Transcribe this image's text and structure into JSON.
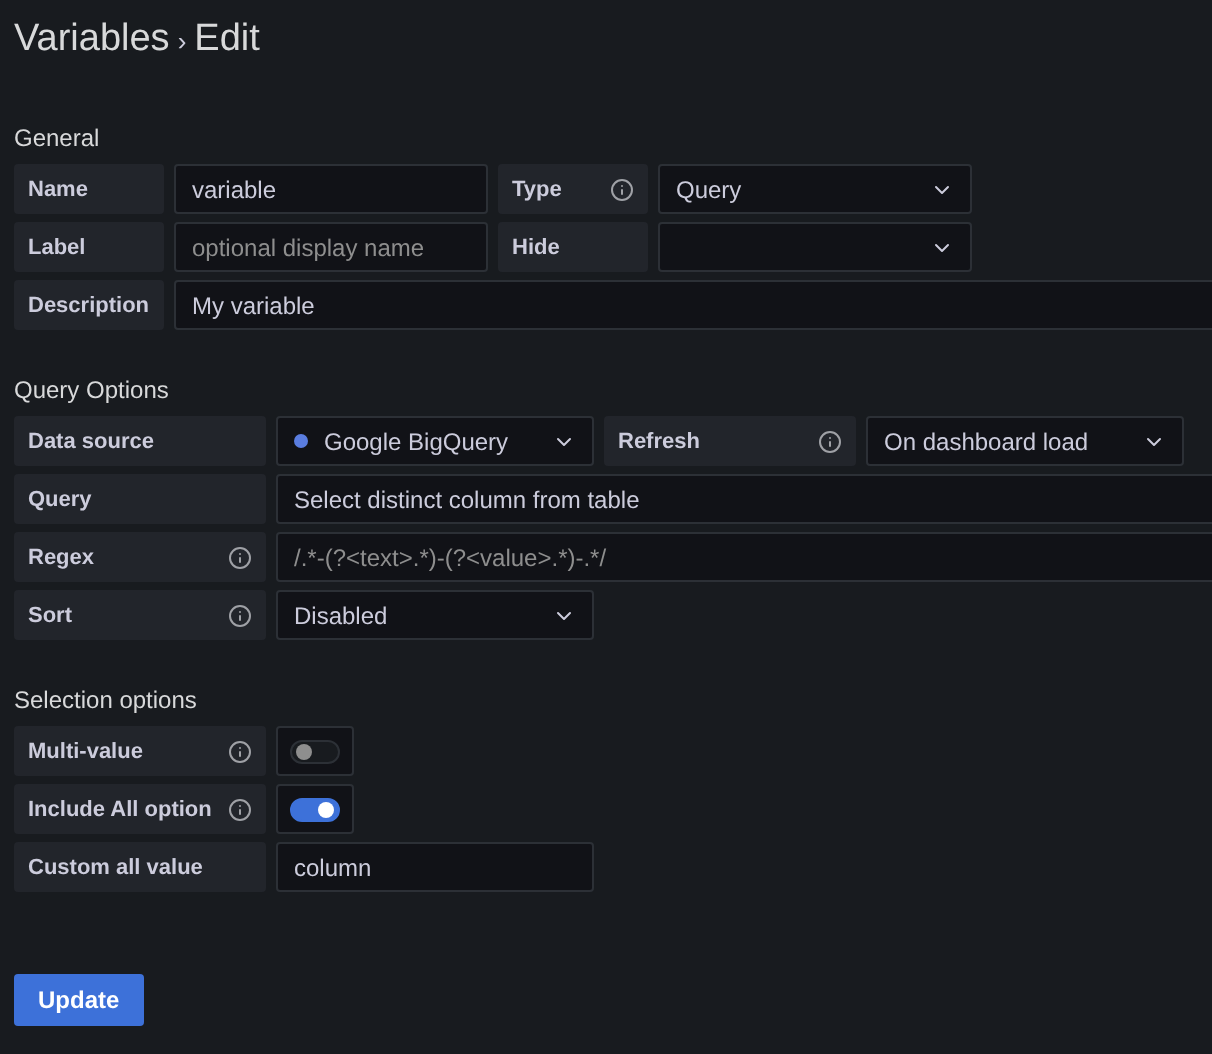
{
  "title": {
    "parent": "Variables",
    "separator": "›",
    "current": "Edit"
  },
  "sections": [
    {
      "heading": "General",
      "rows": [
        [
          {
            "kind": "label",
            "text": "Name",
            "info": false
          },
          {
            "kind": "input",
            "value": "variable"
          },
          {
            "kind": "label",
            "text": "Type",
            "info": true
          },
          {
            "kind": "select",
            "value": "Query"
          }
        ],
        [
          {
            "kind": "label",
            "text": "Label",
            "info": false
          },
          {
            "kind": "input",
            "placeholder": "optional display name"
          },
          {
            "kind": "label",
            "text": "Hide",
            "info": false
          },
          {
            "kind": "select"
          }
        ],
        [
          {
            "kind": "label",
            "text": "Description",
            "info": false
          },
          {
            "kind": "input",
            "value": "My variable"
          }
        ]
      ]
    },
    {
      "heading": "Query Options",
      "rows": [
        [
          {
            "kind": "label",
            "text": "Data source",
            "info": false
          },
          {
            "kind": "select",
            "value": "Google BigQuery",
            "source_dot": true
          },
          {
            "kind": "label",
            "text": "Refresh",
            "info": true
          },
          {
            "kind": "select",
            "value": "On dashboard load"
          }
        ],
        [
          {
            "kind": "label",
            "text": "Query",
            "info": false
          },
          {
            "kind": "input",
            "value": "Select distinct column from table"
          }
        ],
        [
          {
            "kind": "label",
            "text": "Regex",
            "info": true
          },
          {
            "kind": "input",
            "placeholder": "/.*-(?<text>.*)-(?<value>.*)-.*/"
          }
        ],
        [
          {
            "kind": "label",
            "text": "Sort",
            "info": true
          },
          {
            "kind": "select",
            "value": "Disabled"
          }
        ]
      ]
    },
    {
      "heading": "Selection options",
      "rows": [
        [
          {
            "kind": "label",
            "text": "Multi-value",
            "info": true
          },
          {
            "kind": "switch",
            "on": false
          }
        ],
        [
          {
            "kind": "label",
            "text": "Include All option",
            "info": true
          },
          {
            "kind": "switch",
            "on": true
          }
        ],
        [
          {
            "kind": "label",
            "text": "Custom all value",
            "info": false
          },
          {
            "kind": "input",
            "value": "column"
          }
        ]
      ]
    }
  ],
  "update_button": "Update"
}
